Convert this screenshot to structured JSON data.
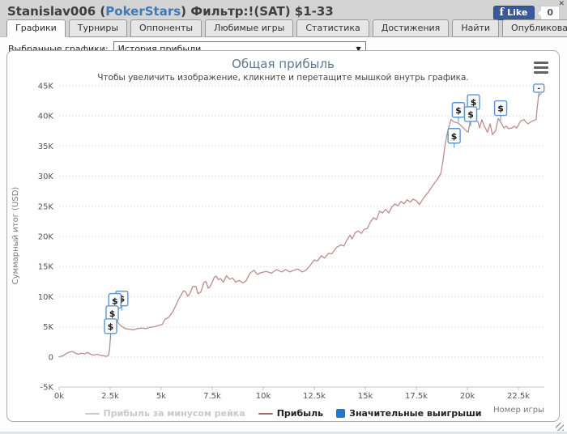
{
  "header": {
    "user_label": "Stanislav006 (",
    "site_label": "PokerStars",
    "filter_label": ") Фильтр:!(SAT) $1-33",
    "fb": {
      "logo_glyph": "f",
      "like_label": "Like",
      "count": "0"
    },
    "close_glyph": "✕"
  },
  "tabs": [
    {
      "name": "graphs",
      "label": "Графики",
      "active": true
    },
    {
      "name": "tournaments",
      "label": "Турниры",
      "active": false
    },
    {
      "name": "opponents",
      "label": "Оппоненты",
      "active": false
    },
    {
      "name": "favorite-games",
      "label": "Любимые игры",
      "active": false
    },
    {
      "name": "statistics",
      "label": "Статистика",
      "active": false
    },
    {
      "name": "achievements",
      "label": "Достижения",
      "active": false
    },
    {
      "name": "find",
      "label": "Найти",
      "active": false
    },
    {
      "name": "publish",
      "label": "Опубликовать",
      "active": false
    }
  ],
  "filter_bar": {
    "label": "Выбранные графики:",
    "selected": "История прибыли",
    "dropdown_arrow": "▼"
  },
  "chart_data": {
    "type": "line",
    "title": "Общая прибыль",
    "subtitle": "Чтобы увеличить изображение, кликните и перетащите мышкой внутрь графика.",
    "xlabel": "Номер игры",
    "ylabel": "Суммарный итог (USD)",
    "units": {
      "x": "thousands of games",
      "y": "thousands of USD"
    },
    "xlim": [
      0,
      23.8
    ],
    "ylim": [
      -5,
      45
    ],
    "grid": "horizontal-dotted",
    "yticks": [
      {
        "v": 45,
        "label": "45K"
      },
      {
        "v": 40,
        "label": "40K"
      },
      {
        "v": 35,
        "label": "35K"
      },
      {
        "v": 30,
        "label": "30K"
      },
      {
        "v": 25,
        "label": "25K"
      },
      {
        "v": 20,
        "label": "20K"
      },
      {
        "v": 15,
        "label": "15K"
      },
      {
        "v": 10,
        "label": "10K"
      },
      {
        "v": 5,
        "label": "5K"
      },
      {
        "v": 0,
        "label": "0"
      },
      {
        "v": -5,
        "label": "-5K"
      }
    ],
    "xticks": [
      {
        "v": 0,
        "label": "0k"
      },
      {
        "v": 2.5,
        "label": "2.5k"
      },
      {
        "v": 5,
        "label": "5k"
      },
      {
        "v": 7.5,
        "label": "7.5k"
      },
      {
        "v": 10,
        "label": "10k"
      },
      {
        "v": 12.5,
        "label": "12.5k"
      },
      {
        "v": 15,
        "label": "15k"
      },
      {
        "v": 17.5,
        "label": "17.5k"
      },
      {
        "v": 20,
        "label": "20k"
      },
      {
        "v": 22.5,
        "label": "22.5k"
      }
    ],
    "legend": [
      {
        "name": "profit-minus-rake",
        "label": "Прибыль за минусом рейка",
        "type": "line",
        "color": "#c9c9c9",
        "text_color": "#c9c9c9",
        "enabled": false
      },
      {
        "name": "profit",
        "label": "Прибыль",
        "type": "line",
        "color": "#a96a6a",
        "text_color": "#222222",
        "enabled": true
      },
      {
        "name": "significant-wins",
        "label": "Значительные выигрыши",
        "type": "flag",
        "color": "#2478cb",
        "text_color": "#222222",
        "enabled": true
      }
    ],
    "series": [
      {
        "name": "Прибыль",
        "color": "#bd8c8c",
        "points": [
          [
            0,
            0
          ],
          [
            0.2,
            0.2
          ],
          [
            0.35,
            0.55
          ],
          [
            0.5,
            0.8
          ],
          [
            0.65,
            0.9
          ],
          [
            0.8,
            0.6
          ],
          [
            0.95,
            0.45
          ],
          [
            1.1,
            0.6
          ],
          [
            1.25,
            0.5
          ],
          [
            1.4,
            0.75
          ],
          [
            1.55,
            0.4
          ],
          [
            1.7,
            0.3
          ],
          [
            1.85,
            0.45
          ],
          [
            2.0,
            0.3
          ],
          [
            2.15,
            0.2
          ],
          [
            2.3,
            0.1
          ],
          [
            2.42,
            0.25
          ],
          [
            2.47,
            1.2
          ],
          [
            2.52,
            3.5
          ],
          [
            2.57,
            6.2
          ],
          [
            2.62,
            8.6
          ],
          [
            2.7,
            7.8
          ],
          [
            2.8,
            6.3
          ],
          [
            2.9,
            5.6
          ],
          [
            3.05,
            5.1
          ],
          [
            3.25,
            4.7
          ],
          [
            3.45,
            4.6
          ],
          [
            3.65,
            4.5
          ],
          [
            3.85,
            4.7
          ],
          [
            4.05,
            4.8
          ],
          [
            4.25,
            4.7
          ],
          [
            4.45,
            4.9
          ],
          [
            4.65,
            5.0
          ],
          [
            4.85,
            5.2
          ],
          [
            5.05,
            5.4
          ],
          [
            5.2,
            6.3
          ],
          [
            5.35,
            6.5
          ],
          [
            5.55,
            7.4
          ],
          [
            5.7,
            8.4
          ],
          [
            5.85,
            9.5
          ],
          [
            6.0,
            10.4
          ],
          [
            6.1,
            11.0
          ],
          [
            6.2,
            10.8
          ],
          [
            6.3,
            10.1
          ],
          [
            6.4,
            10.5
          ],
          [
            6.55,
            11.7
          ],
          [
            6.7,
            11.7
          ],
          [
            6.8,
            10.5
          ],
          [
            6.95,
            10.8
          ],
          [
            7.1,
            12.4
          ],
          [
            7.2,
            12.5
          ],
          [
            7.3,
            11.4
          ],
          [
            7.4,
            11.7
          ],
          [
            7.5,
            12.4
          ],
          [
            7.6,
            13.2
          ],
          [
            7.7,
            13.4
          ],
          [
            7.8,
            12.8
          ],
          [
            7.9,
            13.0
          ],
          [
            8.05,
            12.4
          ],
          [
            8.2,
            13.5
          ],
          [
            8.35,
            12.9
          ],
          [
            8.5,
            13.1
          ],
          [
            8.65,
            12.4
          ],
          [
            8.8,
            12.7
          ],
          [
            9.0,
            12.3
          ],
          [
            9.15,
            12.6
          ],
          [
            9.35,
            13.9
          ],
          [
            9.55,
            14.4
          ],
          [
            9.7,
            13.7
          ],
          [
            9.9,
            14.0
          ],
          [
            10.15,
            14.2
          ],
          [
            10.4,
            13.9
          ],
          [
            10.65,
            14.5
          ],
          [
            10.9,
            14.1
          ],
          [
            11.1,
            14.5
          ],
          [
            11.3,
            14.1
          ],
          [
            11.5,
            14.4
          ],
          [
            11.7,
            14.6
          ],
          [
            11.9,
            14.1
          ],
          [
            12.1,
            14.4
          ],
          [
            12.3,
            15.2
          ],
          [
            12.5,
            16.1
          ],
          [
            12.65,
            15.9
          ],
          [
            12.85,
            16.8
          ],
          [
            13.0,
            16.4
          ],
          [
            13.2,
            17.2
          ],
          [
            13.35,
            17.1
          ],
          [
            13.6,
            18.2
          ],
          [
            13.8,
            18.6
          ],
          [
            13.95,
            18.4
          ],
          [
            14.1,
            19.4
          ],
          [
            14.25,
            20.2
          ],
          [
            14.35,
            19.6
          ],
          [
            14.5,
            20.6
          ],
          [
            14.65,
            20.9
          ],
          [
            14.8,
            20.5
          ],
          [
            14.95,
            21.2
          ],
          [
            15.1,
            21.3
          ],
          [
            15.25,
            22.4
          ],
          [
            15.4,
            23.1
          ],
          [
            15.55,
            22.8
          ],
          [
            15.7,
            24.2
          ],
          [
            15.85,
            23.9
          ],
          [
            16.0,
            24.5
          ],
          [
            16.15,
            23.9
          ],
          [
            16.3,
            24.9
          ],
          [
            16.45,
            25.4
          ],
          [
            16.6,
            25.1
          ],
          [
            16.75,
            25.8
          ],
          [
            16.9,
            25.4
          ],
          [
            17.05,
            26.1
          ],
          [
            17.2,
            25.7
          ],
          [
            17.35,
            26.2
          ],
          [
            17.5,
            25.9
          ],
          [
            17.65,
            25.3
          ],
          [
            17.8,
            26.1
          ],
          [
            17.95,
            26.8
          ],
          [
            18.1,
            27.4
          ],
          [
            18.25,
            28.2
          ],
          [
            18.4,
            28.9
          ],
          [
            18.55,
            29.6
          ],
          [
            18.7,
            30.4
          ],
          [
            18.8,
            32.5
          ],
          [
            18.9,
            35.0
          ],
          [
            19.0,
            36.9
          ],
          [
            19.1,
            38.2
          ],
          [
            19.2,
            39.4
          ],
          [
            19.35,
            39.0
          ],
          [
            19.56,
            38.8
          ],
          [
            19.72,
            38.3
          ],
          [
            19.92,
            37.6
          ],
          [
            20.04,
            37.3
          ],
          [
            20.12,
            38.8
          ],
          [
            20.2,
            40.6
          ],
          [
            20.32,
            39.6
          ],
          [
            20.52,
            39.0
          ],
          [
            20.6,
            38.0
          ],
          [
            20.71,
            39.4
          ],
          [
            20.83,
            38.3
          ],
          [
            20.99,
            37.3
          ],
          [
            21.11,
            38.7
          ],
          [
            21.23,
            36.9
          ],
          [
            21.39,
            37.6
          ],
          [
            21.51,
            39.6
          ],
          [
            21.63,
            39.0
          ],
          [
            21.79,
            38.0
          ],
          [
            21.9,
            38.3
          ],
          [
            22.02,
            37.9
          ],
          [
            22.18,
            38.0
          ],
          [
            22.3,
            38.3
          ],
          [
            22.42,
            38.0
          ],
          [
            22.62,
            39.2
          ],
          [
            22.78,
            39.4
          ],
          [
            22.86,
            39.0
          ],
          [
            22.98,
            38.7
          ],
          [
            23.1,
            39.0
          ],
          [
            23.21,
            39.2
          ],
          [
            23.37,
            39.4
          ],
          [
            23.41,
            41.0
          ],
          [
            23.49,
            43.4
          ],
          [
            23.61,
            43.7
          ]
        ]
      }
    ],
    "flags": {
      "border_color": "#5e94cf",
      "fill_color": "#fbfdff",
      "glyph_color": "#1a1a1a",
      "items": [
        {
          "g": 2.52,
          "v": 5.1,
          "glyph": "$"
        },
        {
          "g": 2.6,
          "v": 7.25,
          "glyph": "$"
        },
        {
          "g": 2.73,
          "v": 9.3,
          "glyph": "$"
        },
        {
          "g": 3.07,
          "v": 9.7,
          "glyph": "$"
        },
        {
          "g": 19.35,
          "v": 36.7,
          "glyph": "$"
        },
        {
          "g": 19.56,
          "v": 41.0,
          "glyph": "$"
        },
        {
          "g": 20.16,
          "v": 40.3,
          "glyph": "$"
        },
        {
          "g": 20.3,
          "v": 42.3,
          "glyph": "$"
        },
        {
          "g": 21.63,
          "v": 41.3,
          "glyph": "$"
        },
        {
          "g": 23.5,
          "v": 44.6,
          "glyph": "-",
          "small": true
        }
      ]
    }
  }
}
